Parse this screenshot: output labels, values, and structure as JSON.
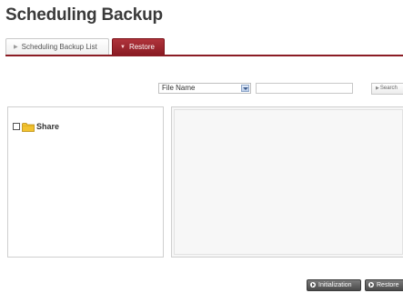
{
  "page": {
    "title": "Scheduling Backup"
  },
  "tabs": [
    {
      "label": "Scheduling Backup List",
      "active": false
    },
    {
      "label": "Restore",
      "active": true
    }
  ],
  "search": {
    "field_selected": "File Name",
    "query_value": "",
    "button_label": "Search"
  },
  "tree": {
    "items": [
      {
        "label": "Share",
        "checked": false,
        "icon": "folder-icon"
      }
    ]
  },
  "actions": {
    "initialization_label": "Initialization",
    "restore_label": "Restore"
  },
  "colors": {
    "accent": "#8b1c24",
    "folder": "#f2c230",
    "button_dark": "#4a4a4a"
  }
}
